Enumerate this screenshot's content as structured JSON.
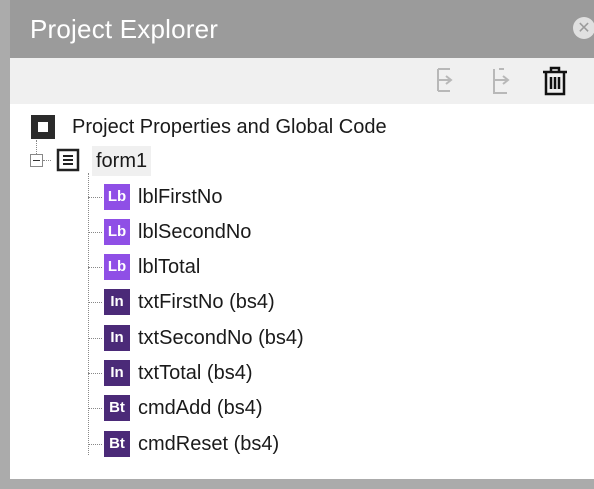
{
  "panel": {
    "title": "Project Explorer",
    "close_icon": "close-icon"
  },
  "toolbar": {
    "buttons": [
      {
        "name": "move-down-button",
        "icon": "move-down-icon"
      },
      {
        "name": "move-up-button",
        "icon": "move-up-icon"
      },
      {
        "name": "delete-button",
        "icon": "trash-icon"
      }
    ]
  },
  "tree": {
    "root": {
      "label": "Project Properties and Global Code",
      "icon": "project-icon"
    },
    "form": {
      "label": "form1",
      "expander": "−",
      "icon": "form-icon"
    },
    "children": [
      {
        "badge": "Lb",
        "label": "lblFirstNo",
        "kind": "label"
      },
      {
        "badge": "Lb",
        "label": "lblSecondNo",
        "kind": "label"
      },
      {
        "badge": "Lb",
        "label": "lblTotal",
        "kind": "label"
      },
      {
        "badge": "In",
        "label": "txtFirstNo (bs4)",
        "kind": "input"
      },
      {
        "badge": "In",
        "label": "txtSecondNo (bs4)",
        "kind": "input"
      },
      {
        "badge": "In",
        "label": "txtTotal (bs4)",
        "kind": "input"
      },
      {
        "badge": "Bt",
        "label": "cmdAdd (bs4)",
        "kind": "button"
      },
      {
        "badge": "Bt",
        "label": "cmdReset (bs4)",
        "kind": "button"
      }
    ]
  },
  "colors": {
    "title_bar": "#9b9b9b",
    "toolbar": "#f0f0f0",
    "label_badge": "#8f4fe6",
    "control_badge": "#4b2a78"
  }
}
